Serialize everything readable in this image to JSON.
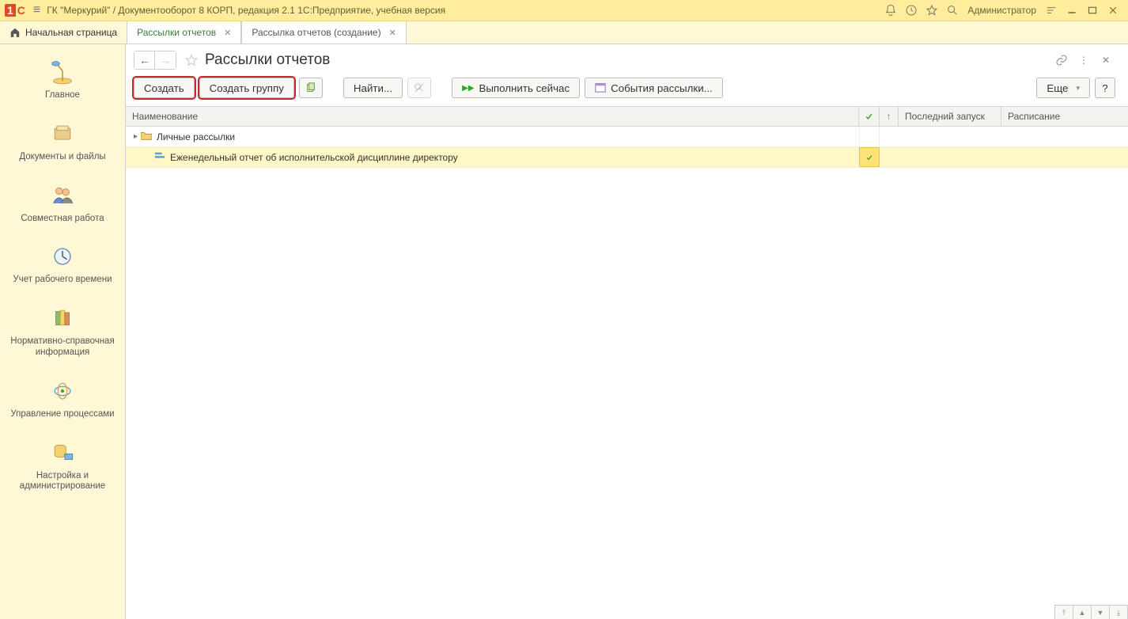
{
  "titlebar": {
    "app_title": "ГК \"Меркурий\" / Документооборот 8 КОРП, редакция 2.1 1С:Предприятие, учебная версия",
    "user_name": "Администратор"
  },
  "tabs": {
    "home": "Начальная страница",
    "items": [
      {
        "label": "Рассылки отчетов",
        "active": true
      },
      {
        "label": "Рассылка отчетов (создание)",
        "active": false
      }
    ]
  },
  "nav": {
    "items": [
      {
        "label": "Главное"
      },
      {
        "label": "Документы и файлы"
      },
      {
        "label": "Совместная работа"
      },
      {
        "label": "Учет рабочего времени"
      },
      {
        "label": "Нормативно-справочная информация"
      },
      {
        "label": "Управление процессами"
      },
      {
        "label": "Настройка и администрирование"
      }
    ]
  },
  "page": {
    "title": "Рассылки отчетов"
  },
  "toolbar": {
    "create": "Создать",
    "create_group": "Создать группу",
    "find": "Найти...",
    "run_now": "Выполнить сейчас",
    "events": "События рассылки...",
    "more": "Еще",
    "help": "?"
  },
  "table": {
    "headers": {
      "name": "Наименование",
      "last_run": "Последний запуск",
      "schedule": "Расписание"
    },
    "group_row": {
      "name": "Личные рассылки"
    },
    "item_row": {
      "name": "Еженедельный отчет об исполнительской дисциплине директору",
      "checked": true
    }
  }
}
